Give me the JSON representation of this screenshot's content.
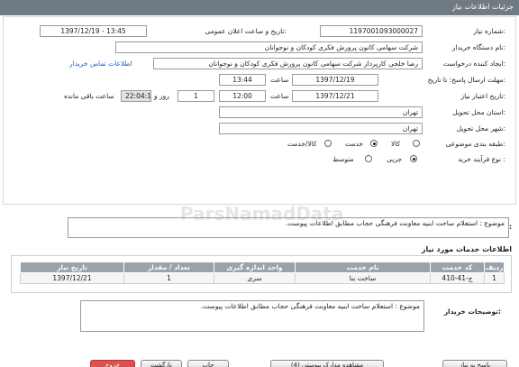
{
  "header": {
    "title": "جزئیات اطلاعات نیاز"
  },
  "form": {
    "need_number_label": "شماره نیاز:",
    "need_number": "1197001093000027",
    "announce_label": "تاریخ و ساعت اعلان عمومی:",
    "announce_value": "1397/12/19 - 13:45",
    "buyer_org_label": "نام دستگاه خریدار:",
    "buyer_org": "شرکت سهامی کانون پرورش فکری کودکان و نوجوانان",
    "creator_label": "ایجاد کننده درخواست:",
    "creator": "رضا خلجی کارپرداز شرکت سهامی کانون پرورش فکری کودکان و نوجوانان",
    "contact_link": "اطلاعات تماس خریدار",
    "send_deadline_label": "مهلت ارسال پاسخ: تا تاریخ:",
    "send_date": "1397/12/19",
    "time_label": "ساعت",
    "send_time": "13:44",
    "validity_label": "تاریخ اعتبار نیاز:",
    "validity_date": "1397/12/21",
    "validity_time": "12:00",
    "days_value": "1",
    "days_label": "روز و",
    "remaining_time": "22:04:12",
    "remaining_label": "ساعت باقی مانده",
    "province_label": "استان محل تحویل:",
    "province": "تهران",
    "city_label": "شهر محل تحویل:",
    "city": "تهران",
    "category_label": "طبقه بندی موضوعی:",
    "cat_goods": "کالا",
    "cat_service": "خدمت",
    "cat_goods_service": "کالا/خدمت",
    "process_label": "نوع فرآیند خرید :",
    "proc_partial": "جزیی",
    "proc_medium": "متوسط"
  },
  "summary": {
    "label": "شرح کلی نیاز:",
    "text": "موضوع : استعلام ساخت ابنیه  معاونت فرهنگی حجاب مطابق اطلاعات پیوست."
  },
  "services": {
    "title": "اطلاعات خدمات مورد نیاز",
    "columns": [
      "ردیف",
      "کد خدمت",
      "نام خدمت",
      "واحد اندازه گیری",
      "تعداد / مقدار",
      "تاریخ نیاز"
    ],
    "rows": [
      [
        "1",
        "ج-41-410",
        "ساخت بنا",
        "سری",
        "1",
        "1397/12/21"
      ]
    ]
  },
  "buyer_notes": {
    "label": "توضیحات خریدار:",
    "text": "موضوع : استعلام ساخت ابنیه  معاونت فرهنگی حجاب مطابق اطلاعات پیوست."
  },
  "buttons": {
    "reply": "پاسخ به نیاز",
    "view_docs": "مشاهده مدارک پیوستی (4)",
    "print": "چاپ",
    "back": "بازگشت",
    "exit": "خروج"
  },
  "watermark": "ParsNamadData"
}
